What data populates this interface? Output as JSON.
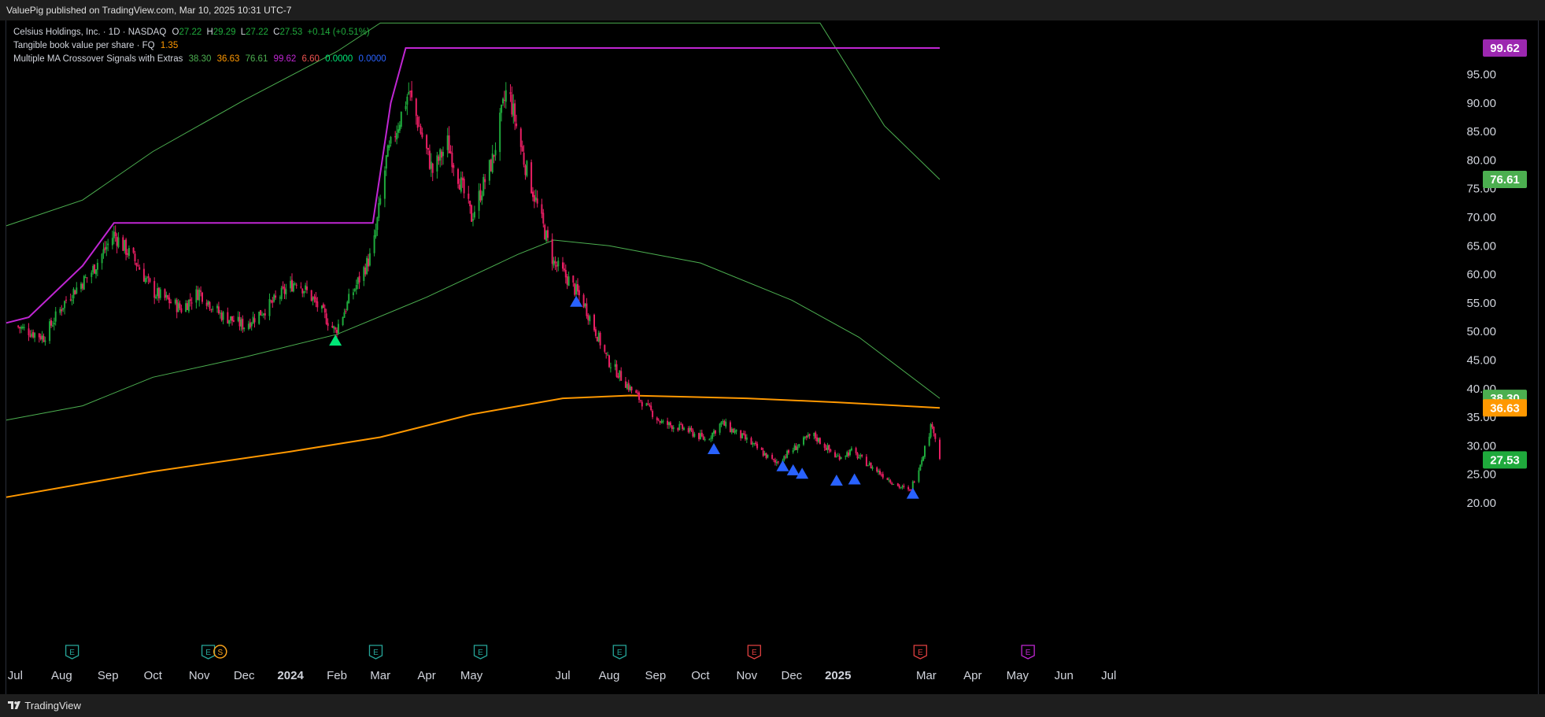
{
  "header": {
    "published": "ValuePig published on TradingView.com, Mar 10, 2025 10:31 UTC-7"
  },
  "legend": {
    "symbol": {
      "name": "Celsius Holdings, Inc. · 1D · NASDAQ",
      "o_label": "O",
      "o": "27.22",
      "h_label": "H",
      "h": "29.29",
      "l_label": "L",
      "l": "27.22",
      "c_label": "C",
      "c": "27.53",
      "change": "+0.14 (+0.51%)"
    },
    "tbv": {
      "name": "Tangible book value per share · FQ",
      "value": "1.35"
    },
    "ma": {
      "name": "Multiple MA Crossover Signals with Extras",
      "v1": "38.30",
      "v2": "36.63",
      "v3": "76.61",
      "v4": "99.62",
      "v5": "6.60",
      "v6": "0.0000",
      "v7": "0.0000"
    }
  },
  "footer": {
    "brand": "TradingView",
    "logo_icon": "tradingview-logo-icon"
  },
  "colors": {
    "up": "#26a69a",
    "candle_up": "#1faa3c",
    "candle_down": "#e91e63",
    "ma_green": "#4caf50",
    "ma_orange": "#ff9800",
    "highline": "#c026d3",
    "signal_blue": "#2962ff",
    "signal_green": "#00e676",
    "earnings_green": "#26a69a",
    "earnings_red": "#e04040",
    "earnings_purple": "#c026d3"
  },
  "chart_data": {
    "type": "candlestick",
    "title": "Celsius Holdings, Inc. · 1D · NASDAQ",
    "ylim": [
      17.5,
      103
    ],
    "y_ticks": [
      "20.00",
      "25.00",
      "30.00",
      "35.00",
      "40.00",
      "45.00",
      "50.00",
      "55.00",
      "60.00",
      "65.00",
      "70.00",
      "75.00",
      "80.00",
      "85.00",
      "90.00",
      "95.00"
    ],
    "x_ticks": [
      "Jul",
      "Aug",
      "Sep",
      "Oct",
      "Nov",
      "Dec",
      "2024",
      "Feb",
      "Mar",
      "Apr",
      "May",
      "Jul",
      "Aug",
      "Sep",
      "Oct",
      "Nov",
      "Dec",
      "2025",
      "Mar",
      "Apr",
      "May",
      "Jun",
      "Jul"
    ],
    "x_tick_bold": [
      "2024",
      "2025"
    ],
    "price_path": [
      [
        "2023-07-01",
        51
      ],
      [
        "2023-07-20",
        49
      ],
      [
        "2023-08-05",
        56
      ],
      [
        "2023-08-20",
        60
      ],
      [
        "2023-09-05",
        67
      ],
      [
        "2023-09-20",
        62
      ],
      [
        "2023-10-01",
        57
      ],
      [
        "2023-10-20",
        54
      ],
      [
        "2023-11-01",
        57
      ],
      [
        "2023-11-15",
        53
      ],
      [
        "2023-12-01",
        51
      ],
      [
        "2023-12-20",
        55
      ],
      [
        "2024-01-05",
        59
      ],
      [
        "2024-01-15",
        56
      ],
      [
        "2024-01-31",
        50
      ],
      [
        "2024-02-10",
        56
      ],
      [
        "2024-02-25",
        64
      ],
      [
        "2024-03-05",
        80
      ],
      [
        "2024-03-20",
        92
      ],
      [
        "2024-04-05",
        78
      ],
      [
        "2024-04-15",
        83
      ],
      [
        "2024-05-01",
        70
      ],
      [
        "2024-05-15",
        80
      ],
      [
        "2024-05-25",
        93
      ],
      [
        "2024-06-05",
        80
      ],
      [
        "2024-06-25",
        62
      ],
      [
        "2024-07-05",
        59
      ],
      [
        "2024-07-15",
        55
      ],
      [
        "2024-07-31",
        45
      ],
      [
        "2024-08-15",
        40
      ],
      [
        "2024-09-05",
        34
      ],
      [
        "2024-09-20",
        33
      ],
      [
        "2024-10-05",
        31
      ],
      [
        "2024-10-15",
        34
      ],
      [
        "2024-11-01",
        31
      ],
      [
        "2024-11-20",
        27
      ],
      [
        "2024-12-05",
        30
      ],
      [
        "2024-12-15",
        32
      ],
      [
        "2024-12-31",
        28
      ],
      [
        "2025-01-10",
        29
      ],
      [
        "2025-01-25",
        26
      ],
      [
        "2025-02-10",
        23
      ],
      [
        "2025-02-18",
        22
      ],
      [
        "2025-02-25",
        27
      ],
      [
        "2025-03-05",
        34
      ],
      [
        "2025-03-10",
        27.5
      ]
    ],
    "series": [
      {
        "name": "MA 1",
        "value": "38.30",
        "points": [
          [
            "2023-06-25",
            34.5
          ],
          [
            "2023-08-15",
            37
          ],
          [
            "2023-10-01",
            42
          ],
          [
            "2023-12-01",
            45.5
          ],
          [
            "2024-02-01",
            49.5
          ],
          [
            "2024-04-01",
            56
          ],
          [
            "2024-06-01",
            63.5
          ],
          [
            "2024-06-25",
            66
          ],
          [
            "2024-08-01",
            65
          ],
          [
            "2024-10-01",
            62
          ],
          [
            "2024-12-01",
            55.5
          ],
          [
            "2025-01-15",
            49
          ],
          [
            "2025-03-10",
            38.3
          ]
        ]
      },
      {
        "name": "MA 2",
        "value": "36.63",
        "points": [
          [
            "2023-06-25",
            21
          ],
          [
            "2023-10-01",
            25.5
          ],
          [
            "2024-01-01",
            29
          ],
          [
            "2024-03-01",
            31.5
          ],
          [
            "2024-05-01",
            35.5
          ],
          [
            "2024-07-01",
            38.3
          ],
          [
            "2024-08-15",
            38.8
          ],
          [
            "2024-11-01",
            38.3
          ],
          [
            "2025-01-01",
            37.6
          ],
          [
            "2025-03-10",
            36.63
          ]
        ]
      },
      {
        "name": "MA 3",
        "value": "76.61",
        "points": [
          [
            "2023-06-25",
            68.5
          ],
          [
            "2023-08-15",
            73
          ],
          [
            "2023-10-01",
            81.5
          ],
          [
            "2023-12-01",
            90.5
          ],
          [
            "2024-02-01",
            99
          ],
          [
            "2024-03-01",
            104
          ],
          [
            "2024-12-20",
            104
          ],
          [
            "2025-02-01",
            86
          ],
          [
            "2025-03-10",
            76.61
          ]
        ]
      },
      {
        "name": "Highest high",
        "value": "99.62",
        "points": [
          [
            "2023-06-25",
            51.5
          ],
          [
            "2023-07-10",
            52.5
          ],
          [
            "2023-08-15",
            61.5
          ],
          [
            "2023-09-05",
            69
          ],
          [
            "2024-02-25",
            69
          ],
          [
            "2024-03-08",
            90
          ],
          [
            "2024-03-18",
            99.62
          ],
          [
            "2025-03-10",
            99.62
          ]
        ]
      }
    ],
    "signals": [
      {
        "date": "2024-01-31",
        "price": 48.5,
        "kind": "green"
      },
      {
        "date": "2024-07-10",
        "price": 55.3,
        "kind": "blue"
      },
      {
        "date": "2024-10-10",
        "price": 29.5,
        "kind": "blue"
      },
      {
        "date": "2024-11-25",
        "price": 26.5,
        "kind": "blue"
      },
      {
        "date": "2024-12-02",
        "price": 25.8,
        "kind": "blue"
      },
      {
        "date": "2024-12-08",
        "price": 25.2,
        "kind": "blue"
      },
      {
        "date": "2024-12-31",
        "price": 24.0,
        "kind": "blue"
      },
      {
        "date": "2025-01-12",
        "price": 24.2,
        "kind": "blue"
      },
      {
        "date": "2025-02-20",
        "price": 21.7,
        "kind": "blue"
      }
    ],
    "events": [
      {
        "date": "2023-08-08",
        "label": "E",
        "kind": "earnings-past"
      },
      {
        "date": "2023-11-07",
        "label": "E",
        "kind": "earnings-past"
      },
      {
        "date": "2023-11-15",
        "label": "S",
        "kind": "split"
      },
      {
        "date": "2024-02-27",
        "label": "E",
        "kind": "earnings-past"
      },
      {
        "date": "2024-05-07",
        "label": "E",
        "kind": "earnings-past"
      },
      {
        "date": "2024-08-08",
        "label": "E",
        "kind": "earnings-past"
      },
      {
        "date": "2024-11-06",
        "label": "E",
        "kind": "earnings-miss"
      },
      {
        "date": "2025-02-25",
        "label": "E",
        "kind": "earnings-miss"
      },
      {
        "date": "2025-05-08",
        "label": "E",
        "kind": "earnings-upcoming"
      }
    ],
    "price_labels": [
      {
        "value": "99.62",
        "price": 99.62,
        "color": "#9c27b0"
      },
      {
        "value": "76.61",
        "price": 76.61,
        "color": "#4caf50"
      },
      {
        "value": "38.30",
        "price": 38.3,
        "color": "#4caf50"
      },
      {
        "value": "36.63",
        "price": 36.63,
        "color": "#ff9800"
      },
      {
        "value": "27.53",
        "price": 27.53,
        "color": "#1faa3c"
      }
    ]
  }
}
